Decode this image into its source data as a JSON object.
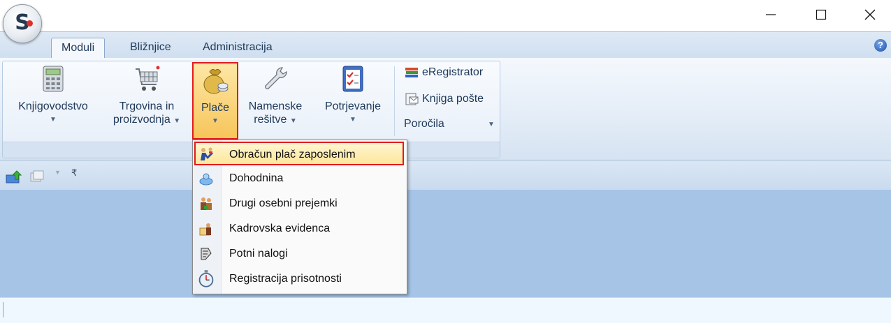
{
  "window": {
    "minimize_icon": "minimize-icon",
    "maximize_icon": "maximize-icon",
    "close_icon": "close-icon"
  },
  "tabs": [
    {
      "label": "Moduli",
      "active": true
    },
    {
      "label": "Bližnjice",
      "active": false
    },
    {
      "label": "Administracija",
      "active": false
    }
  ],
  "ribbon": {
    "buttons": [
      {
        "label1": "Knjigovodstvo",
        "label2": "",
        "icon": "calculator-icon"
      },
      {
        "label1": "Trgovina in",
        "label2": "proizvodnja",
        "icon": "shopping-cart-icon"
      },
      {
        "label1": "Plače",
        "label2": "",
        "icon": "money-bag-icon"
      },
      {
        "label1": "Namenske",
        "label2": "rešitve",
        "icon": "wrench-icon"
      },
      {
        "label1": "Potrjevanje",
        "label2": "",
        "icon": "checklist-icon"
      }
    ],
    "small_buttons": [
      {
        "label": "eRegistrator",
        "icon": "books-icon"
      },
      {
        "label": "Knjiga pošte",
        "icon": "mail-book-icon"
      },
      {
        "label": "Poročila",
        "icon": ""
      }
    ]
  },
  "dropdown": {
    "items": [
      {
        "label": "Obračun plač zaposlenim",
        "icon": "workers-icon"
      },
      {
        "label": "Dohodnina",
        "icon": "income-tax-icon"
      },
      {
        "label": "Drugi osebni prejemki",
        "icon": "people-money-icon"
      },
      {
        "label": "Kadrovska evidenca",
        "icon": "personnel-icon"
      },
      {
        "label": "Potni nalogi",
        "icon": "travel-order-icon"
      },
      {
        "label": "Registracija prisotnosti",
        "icon": "stopwatch-icon"
      }
    ]
  },
  "colors": {
    "highlight_border": "#e21b1b",
    "ribbon_bg": "#e3ecf7",
    "workspace_bg": "#a6c4e6"
  }
}
